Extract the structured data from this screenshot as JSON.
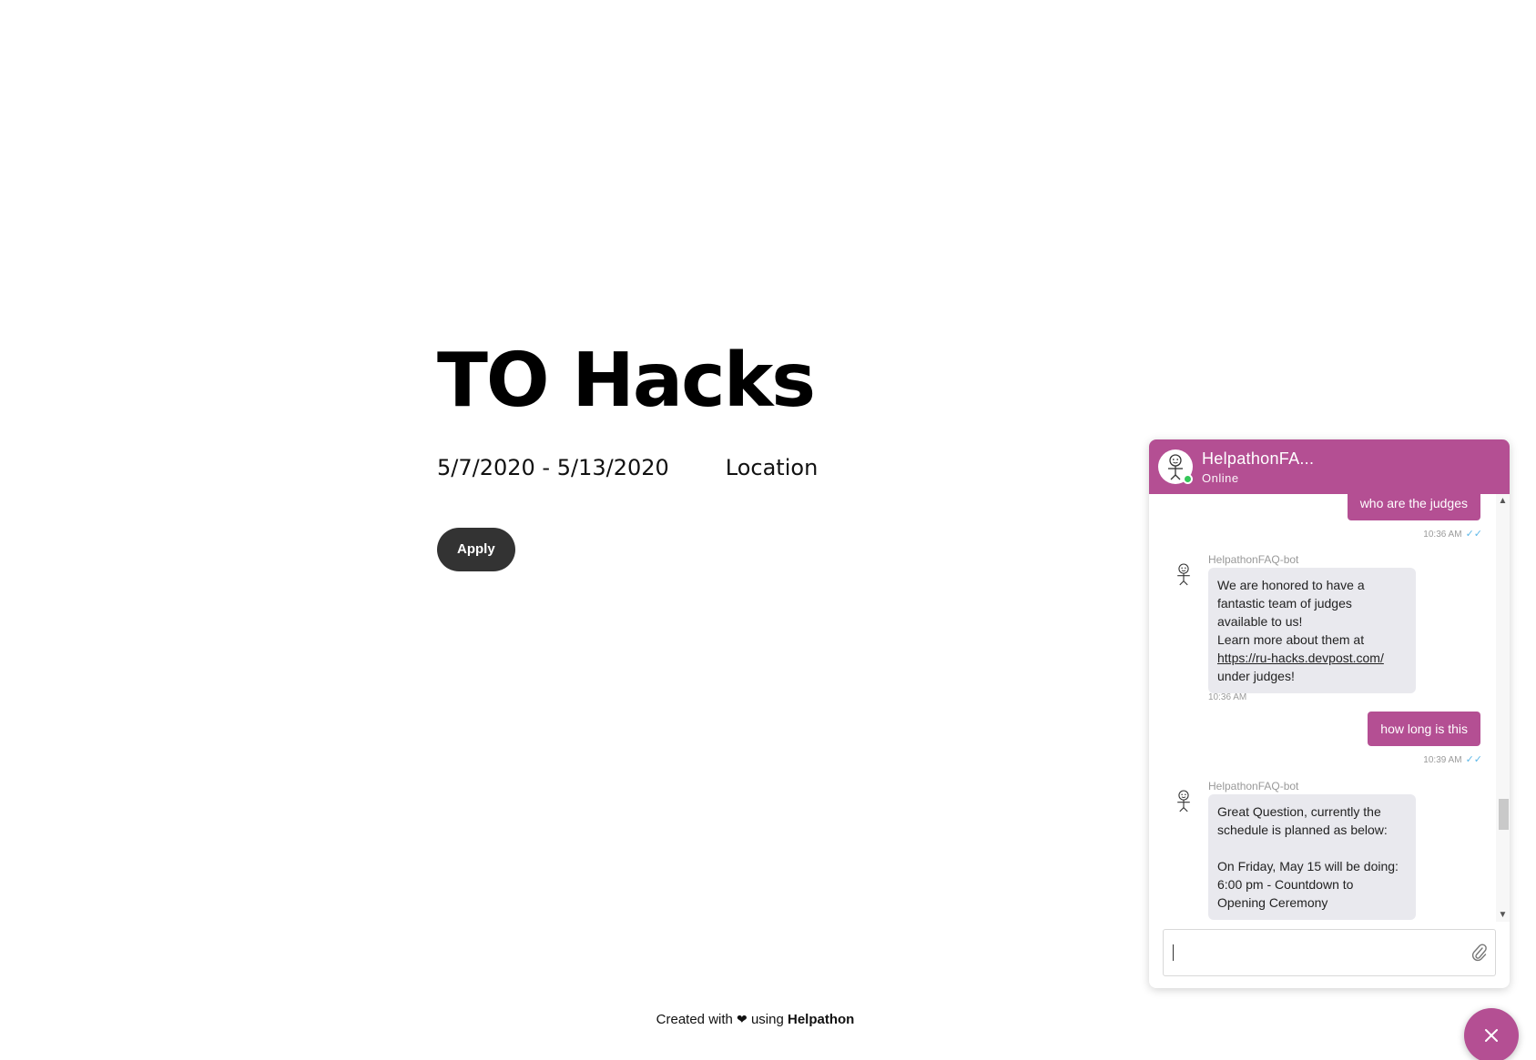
{
  "hero": {
    "title": "TO Hacks",
    "dates": "5/7/2020 - 5/13/2020",
    "location": "Location",
    "apply_label": "Apply"
  },
  "footer": {
    "prefix": "Created with",
    "heart": "❤",
    "middle": "using",
    "brand": "Helpathon"
  },
  "chat": {
    "title": "HelpathonFA...",
    "status": "Online",
    "accent": "#b44f93",
    "messages": {
      "out1": {
        "text": "who are the judges",
        "time": "10:36 AM"
      },
      "bot1": {
        "name": "HelpathonFAQ-bot",
        "lines": [
          "We are honored  to have a",
          "fantastic team of judges",
          "available to us!",
          "Learn more about them at"
        ],
        "link": "https://ru-hacks.devpost.com/",
        "after_link": "under judges!",
        "time": "10:36 AM"
      },
      "out2": {
        "text": "how long is this",
        "time": "10:39 AM"
      },
      "bot2": {
        "name": "HelpathonFAQ-bot",
        "lines": [
          "Great Question, currently the",
          "schedule is planned as below:",
          "",
          "On Friday, May 15 will be doing:",
          "6:00 pm - Countdown to",
          "Opening Ceremony"
        ]
      }
    },
    "ticks": "✓✓"
  }
}
